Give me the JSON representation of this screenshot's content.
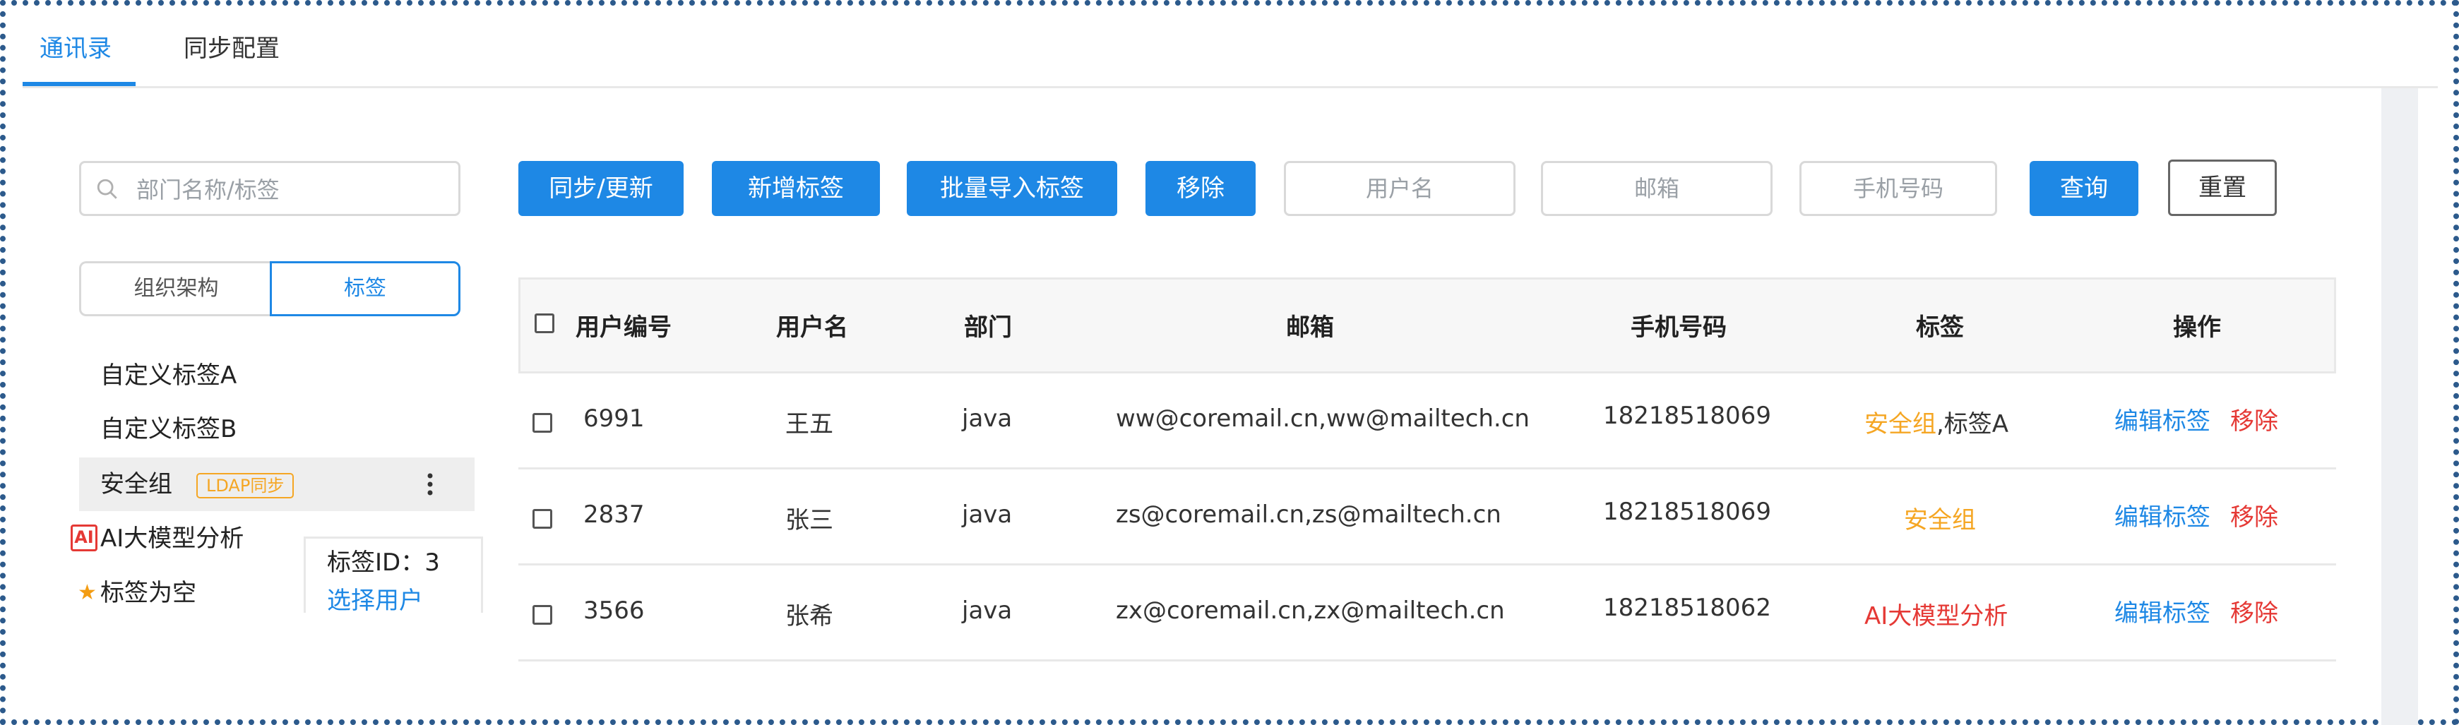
{
  "tabs": [
    {
      "label": "通讯录",
      "active": true
    },
    {
      "label": "同步配置",
      "active": false
    }
  ],
  "left_panel": {
    "search_placeholder": "部门名称/标签",
    "segments": [
      "组织架构",
      "标签"
    ],
    "active_segment": "标签",
    "tags": [
      {
        "label": "自定义标签A"
      },
      {
        "label": "自定义标签B"
      },
      {
        "label": "安全组",
        "badge": "LDAP同步",
        "selected": true
      },
      {
        "label": "AI大模型分析",
        "icon_text": "AI",
        "icon": "ai-icon"
      },
      {
        "label": "标签为空",
        "icon": "star-icon"
      }
    ],
    "popover": {
      "tag_id_label": "标签ID：3",
      "select_user": "选择用户"
    }
  },
  "toolbar": {
    "sync_label": "同步/更新",
    "add_tag_label": "新增标签",
    "batch_import_label": "批量导入标签",
    "remove_label": "移除",
    "username_placeholder": "用户名",
    "email_placeholder": "邮箱",
    "phone_placeholder": "手机号码",
    "query_label": "查询",
    "reset_label": "重置"
  },
  "table": {
    "columns": [
      "用户编号",
      "用户名",
      "部门",
      "邮箱",
      "手机号码",
      "标签",
      "操作"
    ],
    "rows": [
      {
        "id": "6991",
        "name": "王五",
        "dept": "java",
        "email": "ww@coremail.cn,ww@mailtech.cn",
        "phone": "18218518069",
        "tag_primary": "安全组",
        "tag_rest": ",标签A",
        "tag_color": "orange",
        "edit": "编辑标签",
        "remove": "移除"
      },
      {
        "id": "2837",
        "name": "张三",
        "dept": "java",
        "email": "zs@coremail.cn,zs@mailtech.cn",
        "phone": "18218518069",
        "tag_primary": "安全组",
        "tag_rest": "",
        "tag_color": "orange",
        "edit": "编辑标签",
        "remove": "移除"
      },
      {
        "id": "3566",
        "name": "张希",
        "dept": "java",
        "email": "zx@coremail.cn,zx@mailtech.cn",
        "phone": "18218518062",
        "tag_primary": "AI大模型分析",
        "tag_rest": "",
        "tag_color": "red",
        "edit": "编辑标签",
        "remove": "移除"
      }
    ]
  },
  "colors": {
    "primary": "#1e88e5",
    "danger": "#e53935",
    "warning": "#f5a623"
  }
}
